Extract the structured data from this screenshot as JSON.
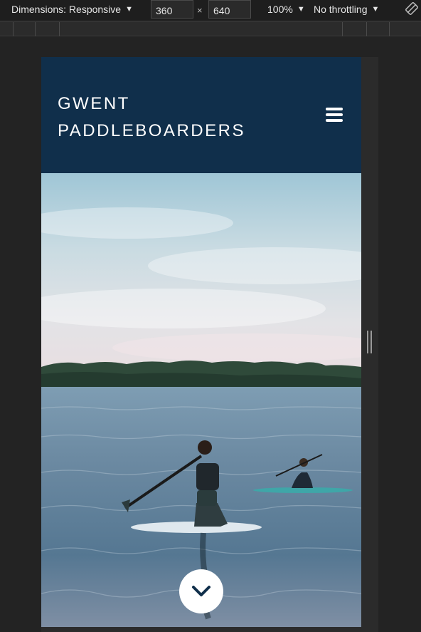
{
  "devtools": {
    "dimensions_label": "Dimensions: Responsive",
    "width_value": "360",
    "height_value": "640",
    "times_symbol": "×",
    "zoom_label": "100%",
    "throttling_label": "No throttling",
    "caret": "▼",
    "icons": {
      "rotate": "rotate-icon",
      "resize": "resize-handle-icon"
    }
  },
  "site": {
    "brand_line1": "GWENT",
    "brand_line2": "PADDLEBOARDERS",
    "menu_icon": "hamburger-menu-icon",
    "hero_image": "hero-image",
    "scroll_icon": "chevron-down-icon",
    "colors": {
      "header_bg": "#102f4b",
      "text": "#ffffff"
    }
  }
}
